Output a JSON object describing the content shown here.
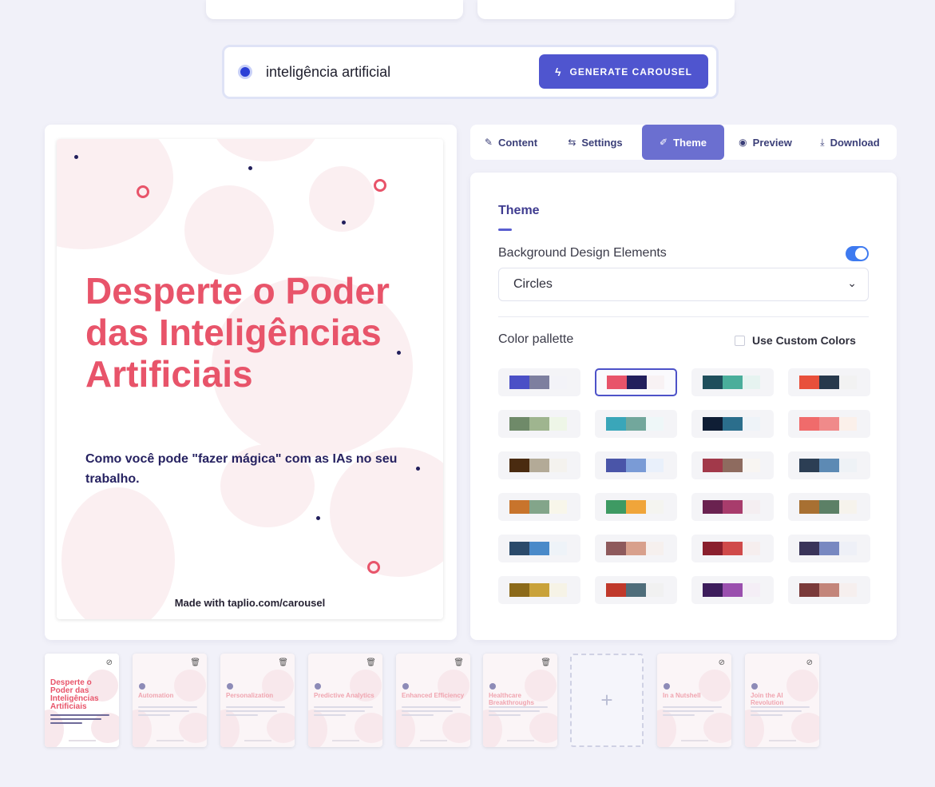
{
  "search": {
    "query": "inteligência artificial",
    "generate_label": "GENERATE CAROUSEL"
  },
  "tabs": [
    {
      "label": "Content",
      "icon": "edit-icon",
      "glyph": "✎"
    },
    {
      "label": "Settings",
      "icon": "sliders-icon",
      "glyph": "⇆"
    },
    {
      "label": "Theme",
      "icon": "brush-icon",
      "glyph": "✐",
      "active": true
    },
    {
      "label": "Preview",
      "icon": "eye-icon",
      "glyph": "◉"
    },
    {
      "label": "Download",
      "icon": "download-icon",
      "glyph": "⤓"
    }
  ],
  "slide": {
    "title": "Desperte o Poder das Inteligências Artificiais",
    "subtitle": "Como você pode \"fazer mágica\" com as IAs no seu trabalho.",
    "footer": "Made with taplio.com/carousel"
  },
  "theme": {
    "heading": "Theme",
    "bg_label": "Background Design Elements",
    "bg_toggle_on": true,
    "bg_select_value": "Circles",
    "color_label": "Color pallette",
    "custom_colors_label": "Use Custom Colors",
    "palettes": [
      {
        "colors": [
          "#4b50c6",
          "#7d7f9f",
          "#f3f3f8"
        ]
      },
      {
        "colors": [
          "#e8546a",
          "#221f5c",
          "#f8f2f4"
        ],
        "selected": true
      },
      {
        "colors": [
          "#1f4f5c",
          "#4aae9b",
          "#e6f3f0"
        ]
      },
      {
        "colors": [
          "#e8503b",
          "#27394c",
          "#f2f2f2"
        ]
      },
      {
        "colors": [
          "#6f8a69",
          "#9fb58f",
          "#eef6e7"
        ]
      },
      {
        "colors": [
          "#3aa6b9",
          "#72a79c",
          "#eef7f8"
        ]
      },
      {
        "colors": [
          "#0f1e35",
          "#2b6e8c",
          "#eef3f8"
        ]
      },
      {
        "colors": [
          "#f06b6b",
          "#f08a8a",
          "#fbf0ea"
        ]
      },
      {
        "colors": [
          "#4a2b10",
          "#b3aa97",
          "#f4f2ee"
        ]
      },
      {
        "colors": [
          "#4a55a8",
          "#7a9bd6",
          "#e9f0fb"
        ]
      },
      {
        "colors": [
          "#a2394a",
          "#8e6b5f",
          "#f8f5f2"
        ]
      },
      {
        "colors": [
          "#2c3e54",
          "#5d8ab4",
          "#eef2f6"
        ]
      },
      {
        "colors": [
          "#c8742c",
          "#83a58a",
          "#f8f6ea"
        ]
      },
      {
        "colors": [
          "#3e9a63",
          "#f0a53a",
          "#f4f4f0"
        ]
      },
      {
        "colors": [
          "#6a2250",
          "#a83c6c",
          "#f4eef1"
        ]
      },
      {
        "colors": [
          "#a87032",
          "#5c8066",
          "#f6f3ec"
        ]
      },
      {
        "colors": [
          "#2b4a6a",
          "#4a8ac9",
          "#eef3f8"
        ]
      },
      {
        "colors": [
          "#8e5a5c",
          "#d8a08c",
          "#f6f0ee"
        ]
      },
      {
        "colors": [
          "#8a1f2d",
          "#d04a4a",
          "#f6eeee"
        ]
      },
      {
        "colors": [
          "#3a3459",
          "#7888c1",
          "#eef0f7"
        ]
      },
      {
        "colors": [
          "#8c6a1a",
          "#c9a23a",
          "#f6f3e6"
        ]
      },
      {
        "colors": [
          "#c0392b",
          "#4f6d7a",
          "#f1f1f1"
        ]
      },
      {
        "colors": [
          "#3d1d5c",
          "#9a4fae",
          "#f4eef6"
        ]
      },
      {
        "colors": [
          "#7a3a3a",
          "#c3857a",
          "#f6efee"
        ]
      }
    ]
  },
  "thumbnails": [
    {
      "title": "Desperte o Poder das Inteligências Artificiais",
      "icon": "eye-off-icon",
      "glyph": "⊘",
      "first": true
    },
    {
      "title": "Automation",
      "icon": "trash-icon",
      "glyph": "🗑"
    },
    {
      "title": "Personalization",
      "icon": "trash-icon",
      "glyph": "🗑"
    },
    {
      "title": "Predictive Analytics",
      "icon": "trash-icon",
      "glyph": "🗑"
    },
    {
      "title": "Enhanced Efficiency",
      "icon": "trash-icon",
      "glyph": "🗑"
    },
    {
      "title": "Healthcare Breakthroughs",
      "icon": "trash-icon",
      "glyph": "🗑"
    },
    {
      "title": "In a Nutshell",
      "icon": "eye-off-icon",
      "glyph": "⊘"
    },
    {
      "title": "Join the AI Revolution",
      "icon": "eye-off-icon",
      "glyph": "⊘"
    }
  ],
  "add_slide_glyph": "+"
}
